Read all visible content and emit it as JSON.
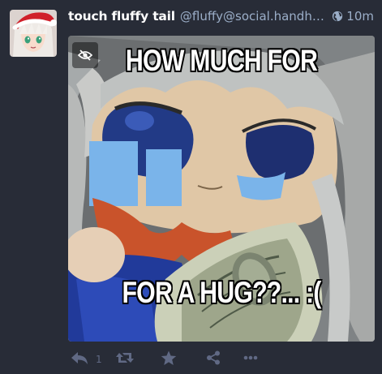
{
  "status": {
    "display_name": "touch fluffy tail",
    "account": "@fluffy@social.handholdin.gs",
    "visibility_icon": "globe-icon",
    "timestamp": "10m"
  },
  "media": {
    "toggle_icon": "eye-slash-icon",
    "caption_top": "HOW MUCH FOR",
    "caption_bottom": "FOR A HUG??... :("
  },
  "actions": {
    "reply_icon": "reply-icon",
    "reply_count": "1",
    "boost_icon": "retweet-icon",
    "favourite_icon": "star-icon",
    "share_icon": "share-icon",
    "more_icon": "ellipsis-icon"
  },
  "colors": {
    "background": "#282c37",
    "name": "#ffffff",
    "secondary_text": "#9baec8",
    "action_icons": "#606984"
  }
}
